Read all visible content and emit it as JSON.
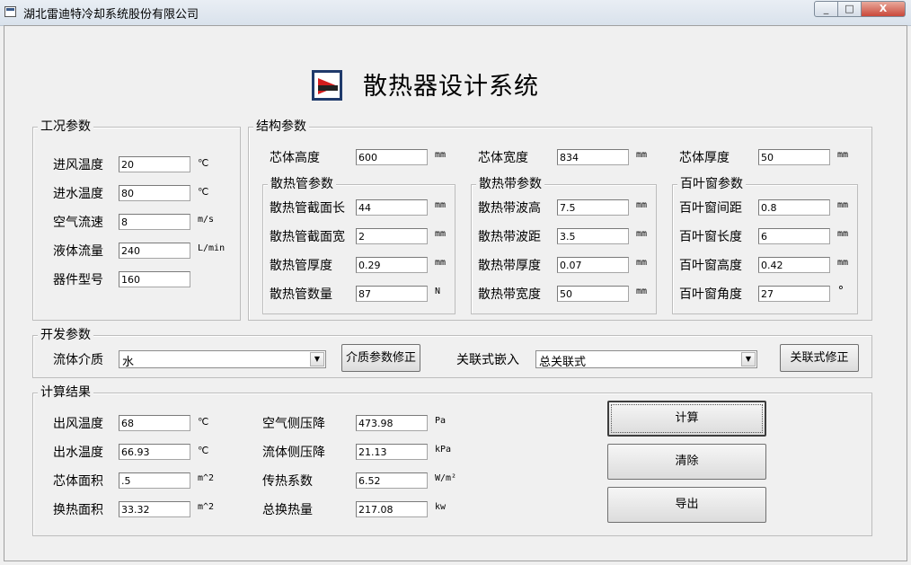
{
  "window": {
    "title": "湖北雷迪特冷却系统股份有限公司",
    "min": "_",
    "max": "□",
    "close": "X"
  },
  "app_title": "散热器设计系统",
  "working": {
    "title": "工况参数",
    "inlet_air_temp": {
      "label": "进风温度",
      "value": "20",
      "unit": "℃"
    },
    "inlet_water_temp": {
      "label": "进水温度",
      "value": "80",
      "unit": "℃"
    },
    "air_velocity": {
      "label": "空气流速",
      "value": "8",
      "unit": "m/s"
    },
    "liquid_flow": {
      "label": "液体流量",
      "value": "240",
      "unit": "L/min"
    },
    "model": {
      "label": "器件型号",
      "value": "160"
    }
  },
  "structure": {
    "title": "结构参数",
    "core_height": {
      "label": "芯体高度",
      "value": "600",
      "unit": "mm"
    },
    "core_width": {
      "label": "芯体宽度",
      "value": "834",
      "unit": "mm"
    },
    "core_thickness": {
      "label": "芯体厚度",
      "value": "50",
      "unit": "mm"
    },
    "tube": {
      "title": "散热管参数",
      "section_length": {
        "label": "散热管截面长",
        "value": "44",
        "unit": "mm"
      },
      "section_width": {
        "label": "散热管截面宽",
        "value": "2",
        "unit": "mm"
      },
      "thickness": {
        "label": "散热管厚度",
        "value": "0.29",
        "unit": "mm"
      },
      "count": {
        "label": "散热管数量",
        "value": "87",
        "unit": "N"
      }
    },
    "fin": {
      "title": "散热带参数",
      "wave_height": {
        "label": "散热带波高",
        "value": "7.5",
        "unit": "mm"
      },
      "wave_pitch": {
        "label": "散热带波距",
        "value": "3.5",
        "unit": "mm"
      },
      "thickness": {
        "label": "散热带厚度",
        "value": "0.07",
        "unit": "mm"
      },
      "width": {
        "label": "散热带宽度",
        "value": "50",
        "unit": "mm"
      }
    },
    "louver": {
      "title": "百叶窗参数",
      "pitch": {
        "label": "百叶窗间距",
        "value": "0.8",
        "unit": "mm"
      },
      "length": {
        "label": "百叶窗长度",
        "value": "6",
        "unit": "mm"
      },
      "height": {
        "label": "百叶窗高度",
        "value": "0.42",
        "unit": "mm"
      },
      "angle": {
        "label": "百叶窗角度",
        "value": "27",
        "unit": "°"
      }
    }
  },
  "development": {
    "title": "开发参数",
    "fluid_label": "流体介质",
    "fluid_value": "水",
    "fluid_fix_button": "介质参数修正",
    "corr_label": "关联式嵌入",
    "corr_value": "总关联式",
    "corr_fix_button": "关联式修正"
  },
  "results": {
    "title": "计算结果",
    "outlet_air_temp": {
      "label": "出风温度",
      "value": "68",
      "unit": "℃"
    },
    "outlet_water_temp": {
      "label": "出水温度",
      "value": "66.93",
      "unit": "℃"
    },
    "core_area": {
      "label": "芯体面积",
      "value": ".5",
      "unit": "m^2"
    },
    "heat_area": {
      "label": "换热面积",
      "value": "33.32",
      "unit": "m^2"
    },
    "air_pressure_drop": {
      "label": "空气侧压降",
      "value": "473.98",
      "unit": "Pa"
    },
    "fluid_pressure_drop": {
      "label": "流体侧压降",
      "value": "21.13",
      "unit": "kPa"
    },
    "heat_coeff": {
      "label": "传热系数",
      "value": "6.52",
      "unit": "W/m²"
    },
    "total_heat": {
      "label": "总换热量",
      "value": "217.08",
      "unit": "kw"
    },
    "calc_button": "计算",
    "clear_button": "清除",
    "export_button": "导出"
  }
}
